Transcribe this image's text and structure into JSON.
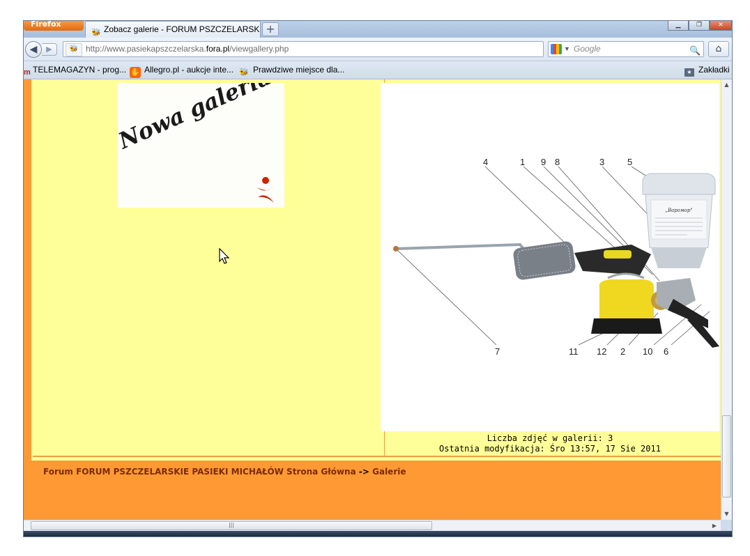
{
  "browser": {
    "menu_button": "Firefox",
    "tab_title": "Zobacz galerie - FORUM PSZCZELARSKI...",
    "new_tab": "+",
    "url_prefix": "http://www.pasiekapszczelarska.",
    "url_domain": "fora.pl",
    "url_path": "/viewgallery.php",
    "search_placeholder": "Google",
    "bookmarks": [
      {
        "label": "TELEMAGAZYN - prog...",
        "icon": "tele-icon"
      },
      {
        "label": "Allegro.pl - aukcje inte...",
        "icon": "allegro-icon"
      },
      {
        "label": "Prawdziwe miejsce dla...",
        "icon": "bee-icon"
      }
    ],
    "bookmarks_menu": "Zakładki"
  },
  "gallery": {
    "new_gallery_image_text": "Nowa galeria",
    "preview_labels_top": [
      "4",
      "1",
      "9",
      "8",
      "3",
      "5"
    ],
    "preview_labels_bottom": [
      "7",
      "11",
      "12",
      "2",
      "10",
      "6"
    ],
    "bottle_label": "„Варомор\"",
    "photo_count": "Liczba zdjęć w galerii: 3",
    "last_modified": "Ostatnia modyfikacja: Śro 13:57, 17 Sie 2011"
  },
  "footer": {
    "home_link": "Forum FORUM PSZCZELARSKIE PASIEKI MICHAŁÓW Strona Główna",
    "separator": "->",
    "gallery_link": "Galerie"
  },
  "colors": {
    "page_bg": "#ff9933",
    "table_bg": "#ffff99",
    "link": "#7a2a0a"
  }
}
